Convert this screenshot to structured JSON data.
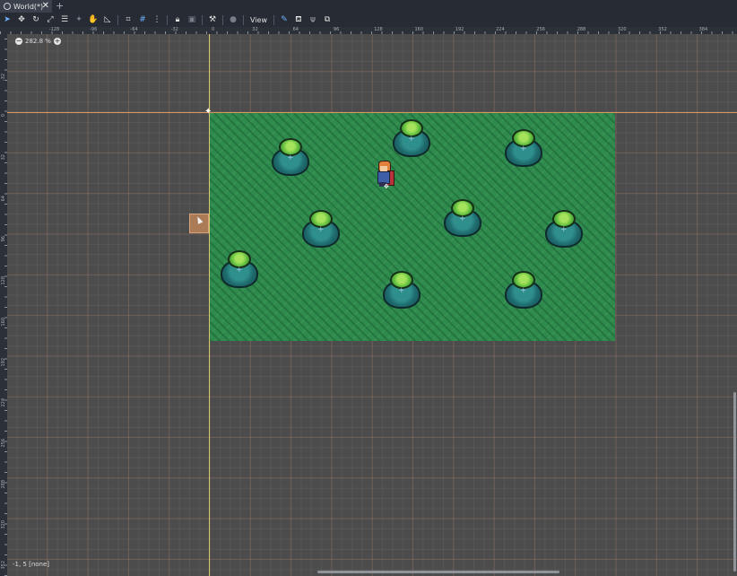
{
  "tab": {
    "title": "World(*)",
    "close": "✕",
    "add": "+"
  },
  "toolbar": {
    "view_label": "View"
  },
  "rulers": {
    "top": [
      "-128",
      "-96",
      "-64",
      "-32",
      "0",
      "32",
      "64",
      "96",
      "128",
      "160",
      "192",
      "224",
      "256",
      "288",
      "320",
      "352",
      "384"
    ],
    "left": [
      "-32",
      "0",
      "32",
      "64",
      "96",
      "128",
      "160",
      "192",
      "224",
      "256",
      "288",
      "320",
      "352"
    ]
  },
  "zoom": {
    "minus": "−",
    "value": "282.8 %",
    "plus": "+"
  },
  "status": {
    "coords": "-1, 5 [none]"
  },
  "colors": {
    "grass": "#2f8a4e",
    "axis_vertical": "#d6c96c",
    "axis_horizontal": "#d39a66",
    "selected_tool": "#6fb2ff"
  }
}
